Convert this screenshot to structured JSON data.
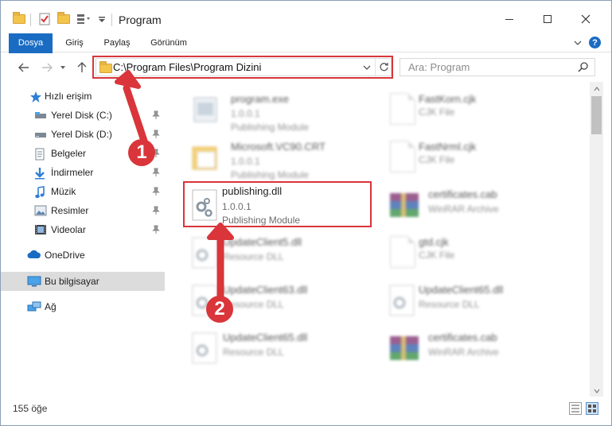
{
  "window": {
    "title": "Program"
  },
  "ribbon": {
    "tabs": [
      "Dosya",
      "Giriş",
      "Paylaş",
      "Görünüm"
    ]
  },
  "address": {
    "path": "C:\\Program Files\\Program Dizini"
  },
  "search": {
    "placeholder": "Ara: Program"
  },
  "sidebar": {
    "items": [
      {
        "label": "Hızlı erişim",
        "icon": "star-icon"
      },
      {
        "label": "Yerel Disk (C:)",
        "icon": "drive-icon",
        "pinned": true
      },
      {
        "label": "Yerel Disk (D:)",
        "icon": "drive-icon",
        "pinned": true
      },
      {
        "label": "Belgeler",
        "icon": "documents-icon",
        "pinned": true
      },
      {
        "label": "İndirmeler",
        "icon": "download-icon",
        "pinned": true
      },
      {
        "label": "Müzik",
        "icon": "music-icon",
        "pinned": true
      },
      {
        "label": "Resimler",
        "icon": "pictures-icon",
        "pinned": true
      },
      {
        "label": "Videolar",
        "icon": "videos-icon",
        "pinned": true
      },
      {
        "label": "OneDrive",
        "icon": "cloud-icon"
      },
      {
        "label": "Bu bilgisayar",
        "icon": "computer-icon",
        "selected": true
      },
      {
        "label": "Ağ",
        "icon": "network-icon"
      }
    ]
  },
  "files": [
    {
      "name": "program.exe",
      "version": "1.0.0.1",
      "desc": "Publishing Module",
      "kind": "exe"
    },
    {
      "name": "FastKorn.cjk",
      "version": "",
      "desc": "CJK File",
      "kind": "doc"
    },
    {
      "name": "Microsoft.VC90.CRT",
      "version": "1.0.0.1",
      "desc": "Publishing Module",
      "kind": "folder"
    },
    {
      "name": "FastNrml.cjk",
      "version": "",
      "desc": "CJK File",
      "kind": "doc"
    },
    {
      "name": "publishing.dll",
      "version": "1.0.0.1",
      "desc": "Publishing Module",
      "kind": "dll"
    },
    {
      "name": "certificates.cab",
      "version": "",
      "desc": "WinRAR Archive",
      "kind": "rar"
    },
    {
      "name": "UpdateClient5.dll",
      "version": "",
      "desc": "Resource DLL",
      "kind": "dll"
    },
    {
      "name": "gtd.cjk",
      "version": "",
      "desc": "CJK File",
      "kind": "doc"
    },
    {
      "name": "UpdateClient63.dll",
      "version": "",
      "desc": "Resource DLL",
      "kind": "dll"
    },
    {
      "name": "UpdateClient65.dll",
      "version": "",
      "desc": "Resource DLL",
      "kind": "dll"
    },
    {
      "name": "UpdateClient65.dll",
      "version": "",
      "desc": "Resource DLL",
      "kind": "dll"
    },
    {
      "name": "certificates.cab",
      "version": "",
      "desc": "WinRAR Archive",
      "kind": "rar"
    }
  ],
  "status": {
    "count": "155 öğe"
  },
  "annotations": {
    "step1": "1",
    "step2": "2",
    "color": "#d9353a"
  },
  "colors": {
    "accent": "#1a6cc3",
    "highlight": "#d9353a"
  }
}
